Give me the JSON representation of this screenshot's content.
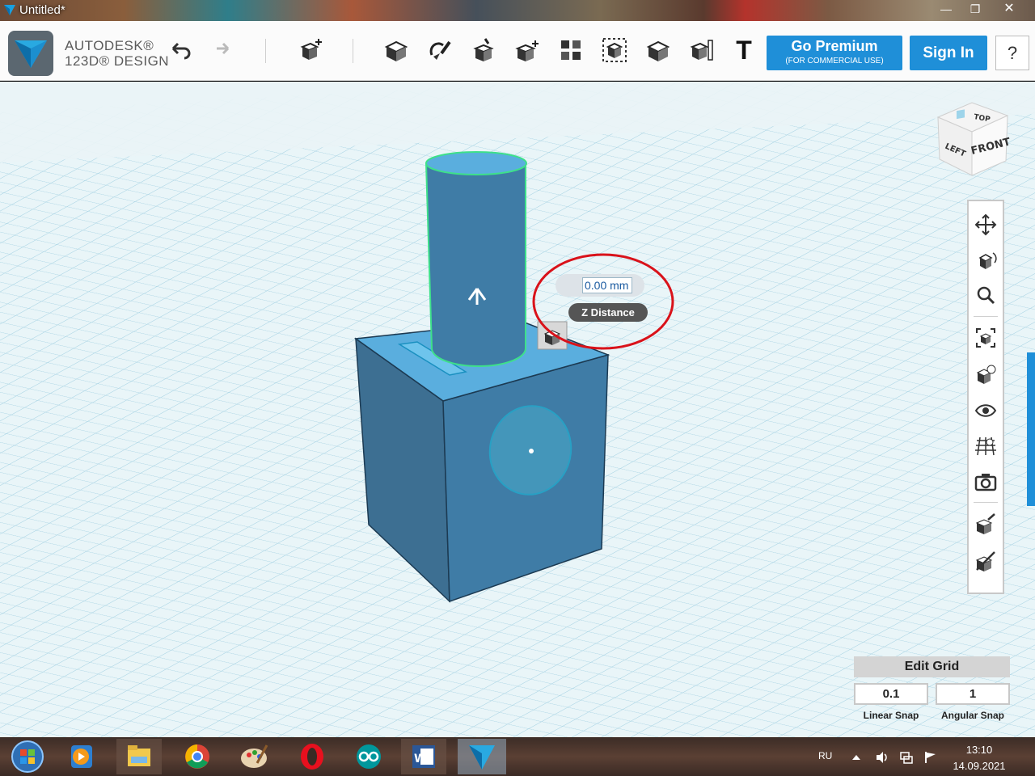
{
  "window": {
    "title": "Untitled*",
    "min_glyph": "—",
    "max_glyph": "❐",
    "close_glyph": "✕"
  },
  "brand": {
    "line1": "AUTODESK®",
    "line2": "123D® DESIGN"
  },
  "toolbar": {
    "premium_main": "Go Premium",
    "premium_sub": "(FOR COMMERCIAL USE)",
    "signin": "Sign In",
    "help": "?",
    "text_tool": "T",
    "icons": [
      "undo-icon",
      "redo-icon",
      "transform-icon",
      "primitives-icon",
      "sketch-icon",
      "construct-icon",
      "modify-icon",
      "pattern-icon",
      "grouping-icon",
      "combine-icon",
      "snap-icon",
      "measure-icon",
      "text-icon"
    ]
  },
  "z_distance": {
    "value": "0.00 mm",
    "label": "Z Distance"
  },
  "viewcube": {
    "top": "TOP",
    "left": "LEFT",
    "front": "FRONT"
  },
  "navbar": {
    "icons": [
      "pan-icon",
      "orbit-icon",
      "zoom-icon",
      "fit-icon",
      "view-icon",
      "visibility-icon",
      "grid-icon",
      "screenshot-icon",
      "material-icon",
      "hide-icon"
    ]
  },
  "edit_grid": {
    "title": "Edit Grid",
    "linear_value": "0.1",
    "angular_value": "1",
    "linear_label": "Linear Snap",
    "angular_label": "Angular Snap"
  },
  "taskbar": {
    "apps": [
      "start-button",
      "media-player-icon",
      "explorer-icon",
      "chrome-icon",
      "paint-icon",
      "opera-icon",
      "arduino-icon",
      "word-icon",
      "123d-design-icon"
    ],
    "language": "RU",
    "time": "13:10",
    "date": "14.09.2021"
  },
  "colors": {
    "accent": "#1f8fd8",
    "selection": "#3ee08a",
    "annotation": "#d9121a",
    "object": "#3f7ca6"
  }
}
